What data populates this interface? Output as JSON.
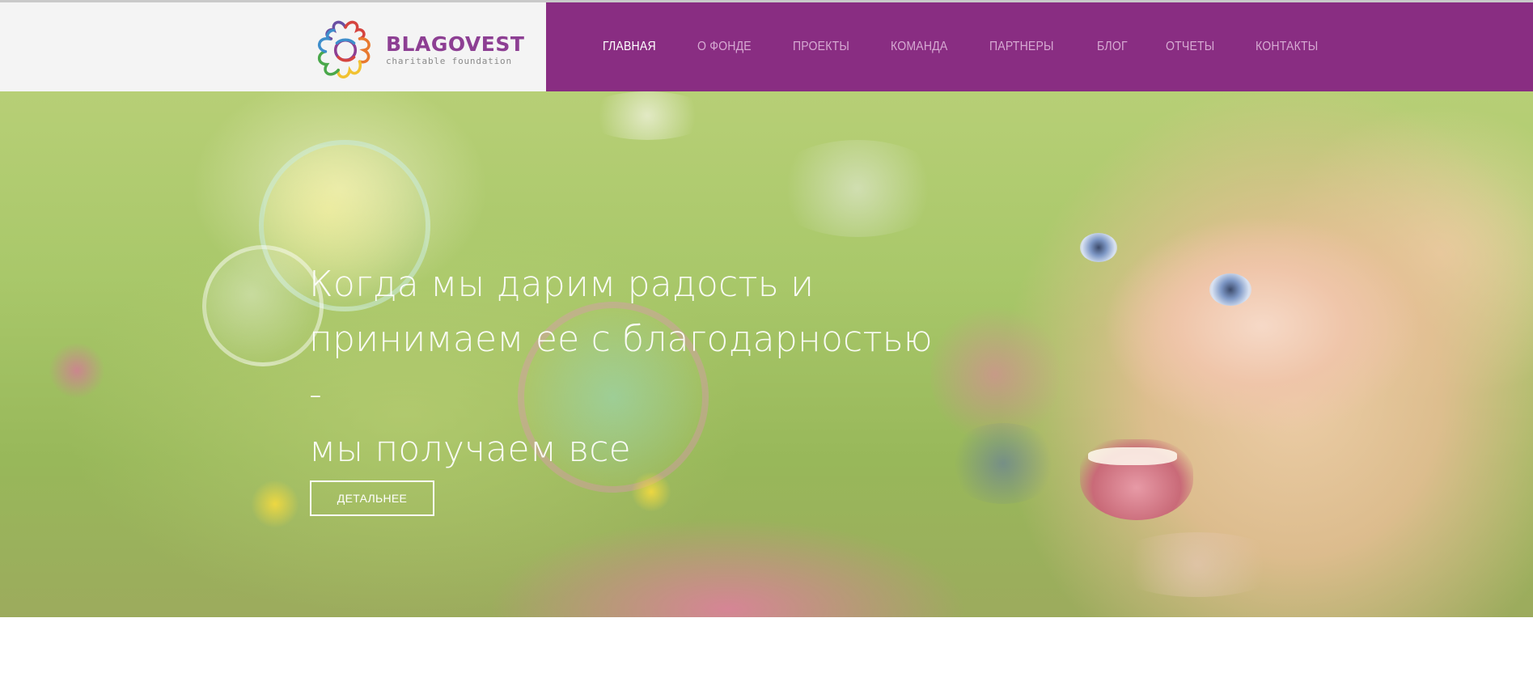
{
  "brand": {
    "name": "BLAGOVEST",
    "tagline": "charitable foundation",
    "colors": {
      "primary": "#892d82",
      "logo_text": "#8d3f93",
      "header_bg": "#f4f4f4"
    }
  },
  "nav": {
    "items": [
      {
        "label": "ГЛАВНАЯ",
        "active": true
      },
      {
        "label": "О ФОНДЕ",
        "active": false
      },
      {
        "label": "ПРОЕКТЫ",
        "active": false
      },
      {
        "label": "КОМАНДА",
        "active": false
      },
      {
        "label": "ПАРТНЕРЫ",
        "active": false
      },
      {
        "label": "БЛОГ",
        "active": false
      },
      {
        "label": "ОТЧЕТЫ",
        "active": false
      },
      {
        "label": "КОНТАКТЫ",
        "active": false
      }
    ]
  },
  "hero": {
    "title_lines": [
      "Когда мы дарим радость и",
      "принимаем ее с благодарностью -",
      "мы получаем все"
    ],
    "button_label": "ДЕТАЛЬНЕЕ",
    "image_subject": "smiling-girl-photo"
  }
}
